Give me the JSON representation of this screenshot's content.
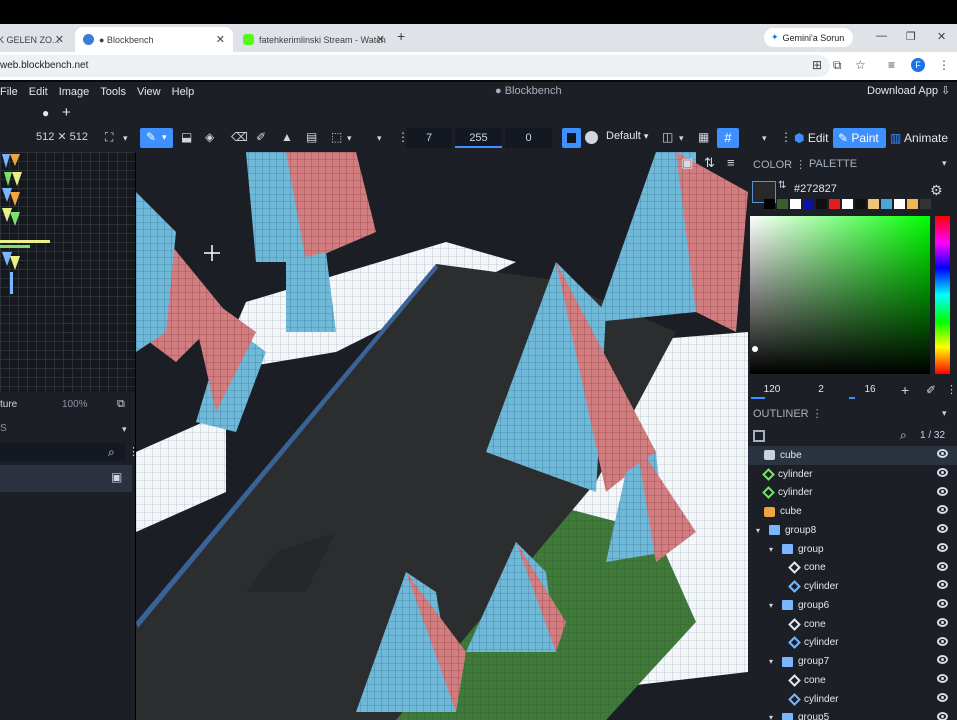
{
  "browser": {
    "tabs": [
      {
        "title": "K GELEN ZO..."
      },
      {
        "title": "● Blockbench"
      },
      {
        "title": "fatehkerimlinski Stream - Watch"
      }
    ],
    "new_tab": "+",
    "gemini_label": "Gemini'a Sorun",
    "url": "web.blockbench.net",
    "profile_initial": "F"
  },
  "app": {
    "menu": [
      "File",
      "Edit",
      "Image",
      "Tools",
      "View",
      "Help"
    ],
    "title": "● Blockbench",
    "download": "Download App",
    "tab_dot": "●",
    "tab_plus": "+"
  },
  "toolbar": {
    "texture_size": "512 ✕ 512",
    "field_a": "7",
    "field_b": "255",
    "field_c": "0",
    "blend_mode": "Default",
    "modes": [
      "Edit",
      "Paint",
      "Animate"
    ]
  },
  "left_panel": {
    "texture_label": "ture",
    "zoom": "100%",
    "section_label": "S"
  },
  "color_panel": {
    "tabs": [
      "COLOR",
      "PALETTE"
    ],
    "hex": "#272827",
    "current_color": "#272827",
    "palette": [
      "#000000",
      "#3a5e2b",
      "#ffffff",
      "#0b13a6",
      "#101010",
      "#e11d1d",
      "#ffffff",
      "#111111",
      "#f0c27a",
      "#4aa6d8",
      "#ffffff",
      "#f3b556",
      "#333333"
    ],
    "hsv": [
      "120",
      "2",
      "16"
    ]
  },
  "outliner": {
    "title": "OUTLINER",
    "count": "1 / 32",
    "items": [
      {
        "label": "cube",
        "icon": "cube",
        "depth": 0,
        "selected": true
      },
      {
        "label": "cylinder",
        "icon": "mesh-g",
        "depth": 0
      },
      {
        "label": "cylinder",
        "icon": "mesh-g",
        "depth": 0
      },
      {
        "label": "cube",
        "icon": "cube-or",
        "depth": 0
      },
      {
        "label": "group8",
        "icon": "folder",
        "depth": 0,
        "group": true
      },
      {
        "label": "group",
        "icon": "folder",
        "depth": 1,
        "group": true
      },
      {
        "label": "cone",
        "icon": "mesh-w",
        "depth": 2
      },
      {
        "label": "cylinder",
        "icon": "mesh-b",
        "depth": 2
      },
      {
        "label": "group6",
        "icon": "folder",
        "depth": 1,
        "group": true
      },
      {
        "label": "cone",
        "icon": "mesh-w",
        "depth": 2
      },
      {
        "label": "cylinder",
        "icon": "mesh-b",
        "depth": 2
      },
      {
        "label": "group7",
        "icon": "folder",
        "depth": 1,
        "group": true
      },
      {
        "label": "cone",
        "icon": "mesh-w",
        "depth": 2
      },
      {
        "label": "cylinder",
        "icon": "mesh-b",
        "depth": 2
      },
      {
        "label": "group5",
        "icon": "folder",
        "depth": 1,
        "group": true
      }
    ]
  }
}
